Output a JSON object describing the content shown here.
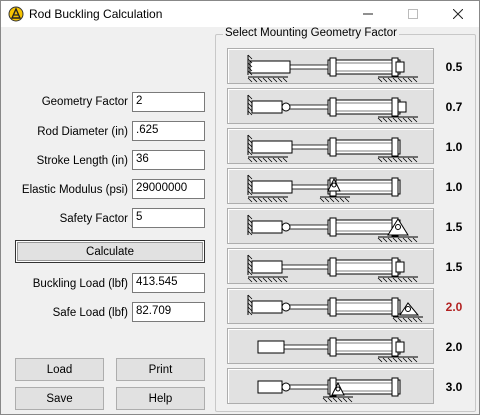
{
  "window": {
    "title": "Rod Buckling Calculation"
  },
  "colors": {
    "selected_factor": "#b22222"
  },
  "inputs": [
    {
      "label": "Geometry Factor",
      "value": "2"
    },
    {
      "label": "Rod Diameter (in)",
      "value": ".625"
    },
    {
      "label": "Stroke Length (in)",
      "value": "36"
    },
    {
      "label": "Elastic Modulus (psi)",
      "value": "29000000"
    },
    {
      "label": "Safety Factor",
      "value": "5"
    }
  ],
  "calculate_label": "Calculate",
  "outputs": [
    {
      "label": "Buckling Load (lbf)",
      "value": "413.545"
    },
    {
      "label": "Safe Load (lbf)",
      "value": "82.709"
    }
  ],
  "bottom_buttons": {
    "load": "Load",
    "print": "Print",
    "save": "Save",
    "help": "Help"
  },
  "geometry": {
    "title": "Select Mounting Geometry Factor",
    "options": [
      {
        "factor": "0.5",
        "icon": "fixed-fixed-mount-icon"
      },
      {
        "factor": "0.7",
        "icon": "pinned-fixed-mount-icon"
      },
      {
        "factor": "1.0",
        "icon": "fixed-rod-guided-mount-icon"
      },
      {
        "factor": "1.0",
        "icon": "fixed-pinned-mount-icon"
      },
      {
        "factor": "1.5",
        "icon": "pinned-pinned-mount-icon"
      },
      {
        "factor": "1.5",
        "icon": "supported-rod-guided-mount-icon"
      },
      {
        "factor": "2.0",
        "icon": "pinned-clevis-mount-icon",
        "selected": true
      },
      {
        "factor": "2.0",
        "icon": "fixed-free-mount-icon"
      },
      {
        "factor": "3.0",
        "icon": "pinned-free-mount-icon"
      }
    ]
  }
}
